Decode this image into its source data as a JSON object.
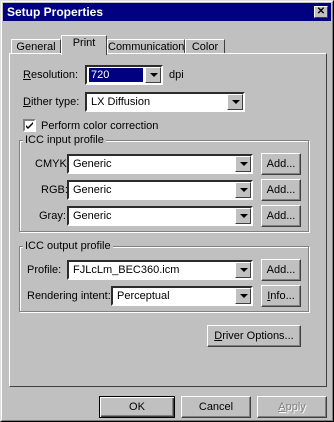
{
  "window": {
    "title": "Setup Properties",
    "close_glyph": "✕"
  },
  "tabs": [
    {
      "label": "General"
    },
    {
      "label": "Print"
    },
    {
      "label": "Communication"
    },
    {
      "label": "Color"
    }
  ],
  "resolution": {
    "label": "Resolution:",
    "value": "720",
    "unit": "dpi"
  },
  "dither": {
    "label": "Dither type:",
    "value": "LX Diffusion"
  },
  "color_correction": {
    "label": "Perform color correction",
    "checked": true
  },
  "icc_input": {
    "title": "ICC input profile",
    "rows": [
      {
        "label": "CMYK:",
        "value": "Generic",
        "button": "Add..."
      },
      {
        "label": "RGB:",
        "value": "Generic",
        "button": "Add..."
      },
      {
        "label": "Gray:",
        "value": "Generic",
        "button": "Add..."
      }
    ]
  },
  "icc_output": {
    "title": "ICC output profile",
    "profile_label": "Profile:",
    "profile_value": "FJLcLm_BEC360.icm",
    "profile_button": "Add...",
    "intent_label": "Rendering intent:",
    "intent_value": "Perceptual",
    "intent_button": "Info..."
  },
  "driver_options_button": "Driver Options...",
  "footer": {
    "ok": "OK",
    "cancel": "Cancel",
    "apply": "Apply"
  }
}
